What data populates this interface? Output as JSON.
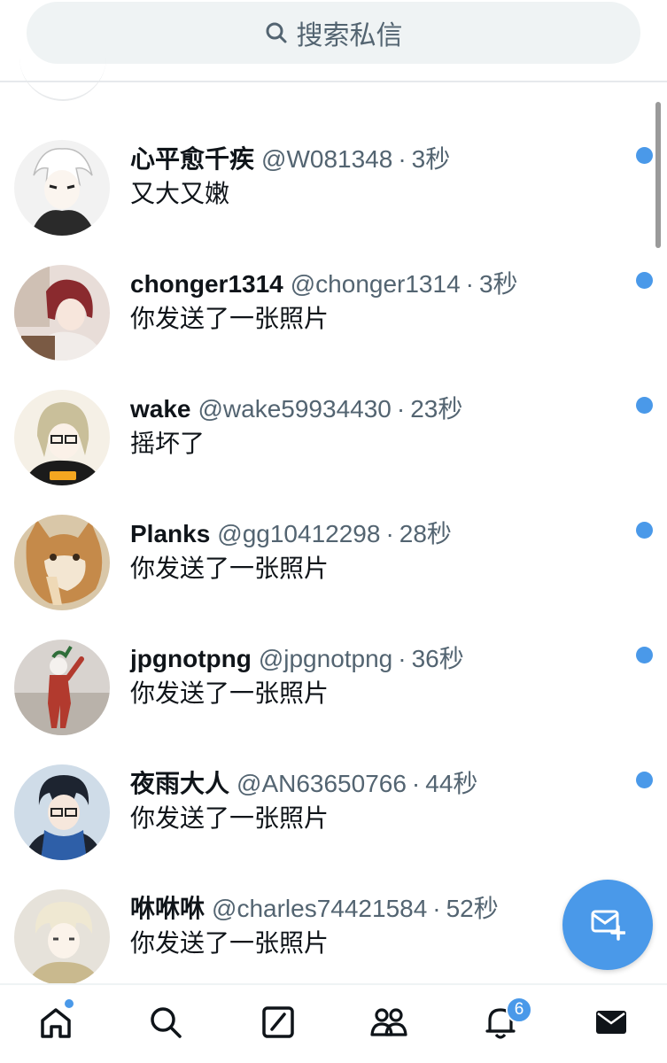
{
  "search": {
    "placeholder": "搜索私信",
    "icon": "search-icon"
  },
  "conversations": [
    {
      "name": "心平愈千疾",
      "handle": "@W081348",
      "time": "3秒",
      "preview": "又大又嫩",
      "unread": true,
      "avatar_colors": [
        "#f2f2f2",
        "#2a2a2a"
      ]
    },
    {
      "name": "chonger1314",
      "handle": "@chonger1314",
      "time": "3秒",
      "preview": "你发送了一张照片",
      "unread": true,
      "avatar_colors": [
        "#e8ddd8",
        "#8a2a2e"
      ]
    },
    {
      "name": "wake",
      "handle": "@wake59934430",
      "time": "23秒",
      "preview": "摇坏了",
      "unread": true,
      "avatar_colors": [
        "#f5f0e6",
        "#1b1b1b"
      ]
    },
    {
      "name": "Planks",
      "handle": "@gg10412298",
      "time": "28秒",
      "preview": "你发送了一张照片",
      "unread": true,
      "avatar_colors": [
        "#d9c7a8",
        "#c58a4a"
      ]
    },
    {
      "name": "jpgnotpng",
      "handle": "@jpgnotpng",
      "time": "36秒",
      "preview": "你发送了一张照片",
      "unread": true,
      "avatar_colors": [
        "#d8d3cf",
        "#b23a2e"
      ]
    },
    {
      "name": "夜雨大人",
      "handle": "@AN63650766",
      "time": "44秒",
      "preview": "你发送了一张照片",
      "unread": true,
      "avatar_colors": [
        "#cfdce8",
        "#2e5fa8"
      ]
    },
    {
      "name": "咻咻咻",
      "handle": "@charles74421584",
      "time": "52秒",
      "preview": "你发送了一张照片",
      "unread": false,
      "avatar_colors": [
        "#e6e2da",
        "#c9b98e"
      ]
    }
  ],
  "fab": {
    "icon": "new-message-icon"
  },
  "bottom_nav": {
    "items": [
      "home-icon",
      "search-icon",
      "compose-icon",
      "communities-icon",
      "notifications-icon",
      "messages-icon"
    ],
    "notification_count": "6"
  },
  "colors": {
    "accent": "#4a99e9",
    "secondary_text": "#536471",
    "search_bg": "#eff3f4"
  }
}
